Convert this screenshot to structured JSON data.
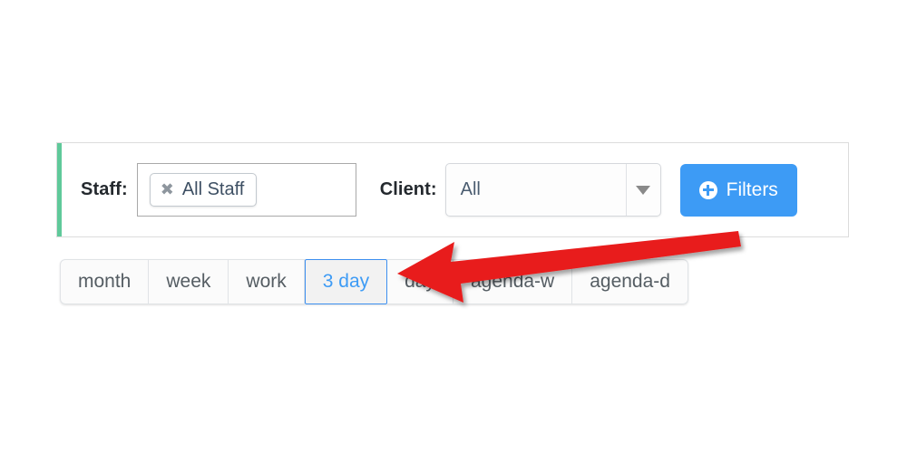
{
  "filter_panel": {
    "accent_color": "#5fc99a",
    "staff": {
      "label": "Staff:",
      "tag_remove_icon": "close-x-icon",
      "tag_remove_glyph": "✖",
      "tag_value": "All Staff"
    },
    "client": {
      "label": "Client:",
      "value": "All",
      "arrow_icon": "chevron-down-icon",
      "options": [
        "All"
      ]
    },
    "filters_button": {
      "label": "Filters",
      "icon": "plus-circle-icon",
      "color": "#3d9bf5"
    }
  },
  "view_switcher": {
    "active": "3 day",
    "active_color": "#3d9bf5",
    "buttons": [
      {
        "label": "month",
        "active": false
      },
      {
        "label": "week",
        "active": false
      },
      {
        "label": "work",
        "active": false
      },
      {
        "label": "3 day",
        "active": true
      },
      {
        "label": "day",
        "active": false
      },
      {
        "label": "agenda-w",
        "active": false
      },
      {
        "label": "agenda-d",
        "active": false
      }
    ]
  },
  "annotation": {
    "arrow_color": "#e81c1c",
    "points_to": "3 day"
  }
}
